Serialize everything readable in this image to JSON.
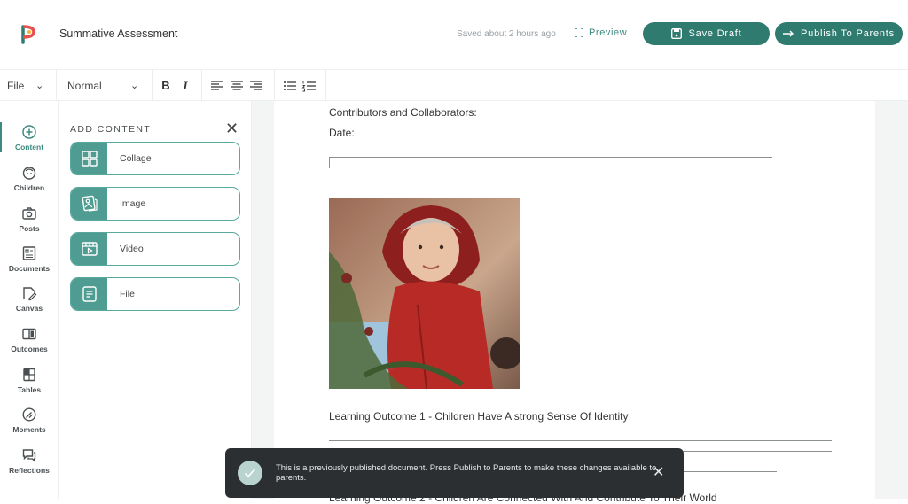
{
  "header": {
    "title": "Summative Assessment",
    "saved_status": "Saved about 2 hours ago",
    "preview_label": "Preview",
    "save_draft_label": "Save Draft",
    "publish_label": "Publish To Parents",
    "accent_color": "#2f7b6f"
  },
  "toolbar": {
    "file_menu": "File",
    "style_select": "Normal",
    "bold": "B",
    "italic": "I"
  },
  "nav": {
    "items": [
      {
        "label": "Content",
        "icon": "plus-circle-icon"
      },
      {
        "label": "Children",
        "icon": "child-face-icon"
      },
      {
        "label": "Posts",
        "icon": "camera-icon"
      },
      {
        "label": "Documents",
        "icon": "document-icon"
      },
      {
        "label": "Canvas",
        "icon": "canvas-icon"
      },
      {
        "label": "Outcomes",
        "icon": "outcomes-icon"
      },
      {
        "label": "Tables",
        "icon": "table-icon"
      },
      {
        "label": "Moments",
        "icon": "moments-icon"
      },
      {
        "label": "Reflections",
        "icon": "reflections-icon"
      }
    ]
  },
  "panel": {
    "title": "ADD CONTENT",
    "items": [
      {
        "label": "Collage",
        "icon": "collage-icon"
      },
      {
        "label": "Image",
        "icon": "image-icon"
      },
      {
        "label": "Video",
        "icon": "video-icon"
      },
      {
        "label": "File",
        "icon": "file-icon"
      }
    ]
  },
  "document": {
    "contributors_label": "Contributors and Collaborators:",
    "date_label": "Date:",
    "outcome_1": "Learning Outcome 1 - Children Have A strong Sense Of Identity",
    "outcome_2": "Learning Outcome 2 - Children Are Connected With And Contribute To Their World"
  },
  "toast": {
    "message": "This is a previously published document. Press Publish to Parents to make these changes available to parents."
  }
}
